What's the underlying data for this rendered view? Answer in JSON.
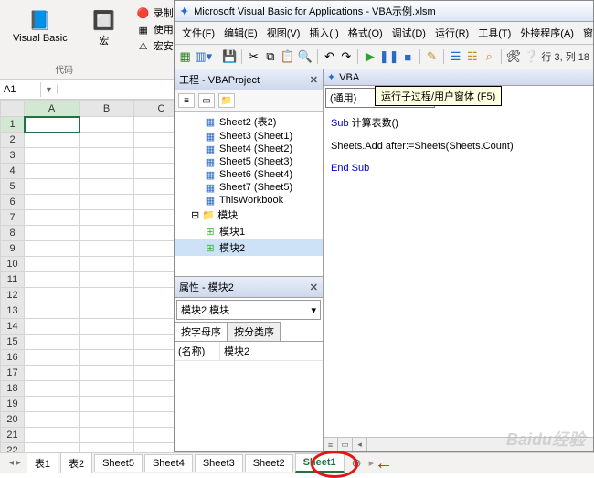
{
  "excel": {
    "ribbon": {
      "visual_basic": "Visual Basic",
      "macro": "宏",
      "record_macro": "录制宏",
      "use_relative_ref": "使用相对引用",
      "macro_security": "宏安全性",
      "group_code": "代码"
    },
    "name_box": "A1",
    "columns": [
      "A",
      "B",
      "C"
    ],
    "rows": [
      "1",
      "2",
      "3",
      "4",
      "5",
      "6",
      "7",
      "8",
      "9",
      "10",
      "11",
      "12",
      "13",
      "14",
      "15",
      "16",
      "17",
      "18",
      "19",
      "20",
      "21",
      "22"
    ],
    "selected_cell": "A1",
    "sheet_tabs": [
      "表1",
      "表2",
      "Sheet5",
      "Sheet4",
      "Sheet3",
      "Sheet2",
      "Sheet1"
    ],
    "active_tab": "Sheet1"
  },
  "vba": {
    "title": "Microsoft Visual Basic for Applications - VBA示例.xlsm",
    "menu": [
      "文件(F)",
      "编辑(E)",
      "视图(V)",
      "插入(I)",
      "格式(O)",
      "调试(D)",
      "运行(R)",
      "工具(T)",
      "外接程序(A)",
      "窗口("
    ],
    "toolbar_status": "行 3, 列 18",
    "run_tooltip": "运行子过程/用户窗体 (F5)",
    "project": {
      "title": "工程 - VBAProject",
      "items": [
        {
          "label": "Sheet2 (表2)",
          "type": "sheet"
        },
        {
          "label": "Sheet3 (Sheet1)",
          "type": "sheet"
        },
        {
          "label": "Sheet4 (Sheet2)",
          "type": "sheet"
        },
        {
          "label": "Sheet5 (Sheet3)",
          "type": "sheet"
        },
        {
          "label": "Sheet6 (Sheet4)",
          "type": "sheet"
        },
        {
          "label": "Sheet7 (Sheet5)",
          "type": "sheet"
        },
        {
          "label": "ThisWorkbook",
          "type": "sheet"
        }
      ],
      "modules_folder": "模块",
      "modules": [
        "模块1",
        "模块2"
      ]
    },
    "properties": {
      "title": "属性 - 模块2",
      "combo": "模块2 模块",
      "tab_alpha": "按字母序",
      "tab_cat": "按分类序",
      "name_key": "(名称)",
      "name_val": "模块2"
    },
    "code": {
      "child_title_prefix": "VBA",
      "dropdown": "(通用)",
      "line1_kw": "Sub",
      "line1_rest": " 计算表数()",
      "line2": "Sheets.Add after:=Sheets(Sheets.Count)",
      "line3_kw": "End Sub"
    }
  },
  "watermark": "Baidu经验"
}
